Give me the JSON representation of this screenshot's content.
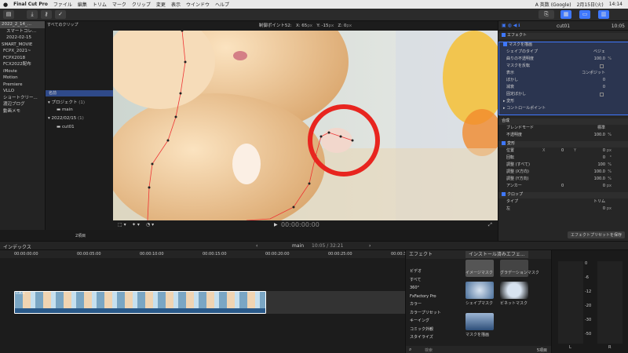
{
  "menubar": {
    "app": "Final Cut Pro",
    "items": [
      "ファイル",
      "編集",
      "トリム",
      "マーク",
      "クリップ",
      "変更",
      "表示",
      "ウインドウ",
      "ヘルプ"
    ],
    "input": "A 英数 (Google)",
    "date": "2月15日(火)",
    "time": "14:14"
  },
  "library": {
    "items": [
      "2022_2_14_...",
      "スマートコレ...",
      "2022-02-15",
      "SMART_MOVIE",
      "FCPX_2021~",
      "FCPX2018",
      "FCX2022配布",
      "iMovie",
      "Motion",
      "Premiere",
      "VLLO",
      "ショートクリー...",
      "渡辺ブログ",
      "動画メモ"
    ]
  },
  "browser": {
    "filter": "すべてのクリップ",
    "col_header": "名前",
    "items": [
      {
        "label": "プロジェクト",
        "count": "(1)"
      },
      {
        "label": "main",
        "count": ""
      },
      {
        "label": "2022/02/15",
        "count": "(1)"
      },
      {
        "label": "cut01",
        "count": ""
      }
    ],
    "footer": "2項目"
  },
  "viewer": {
    "hud": "制御ポイント52:",
    "x": "X: 65",
    "xunit": "px",
    "y": "Y: -15",
    "yunit": "px",
    "z": "Z: 0",
    "zunit": "px",
    "timecode": "00:00:00:00"
  },
  "inspector": {
    "clipname": "cut01",
    "duration": "10:05",
    "effects_label": "エフェクト",
    "mask_label": "マスクを描画",
    "shape_type_label": "シェイプのタイプ",
    "shape_type_value": "ベジェ",
    "outer_opacity_label": "曲りの不透明度",
    "outer_opacity_value": "100.0",
    "invert_label": "マスクを反転",
    "display_label": "表示",
    "display_value": "コンポジット",
    "feather_label": "ぼかし",
    "feather_value": "0",
    "falloff_label": "減衰",
    "falloff_value": "0",
    "fixed_label": "固定ぼかし",
    "transform_label": "変形",
    "control_label": "コントロールポイント",
    "composite_label": "合成",
    "blend_label": "ブレンドモード",
    "blend_value": "標準",
    "opacity_label": "不透明度",
    "opacity_value": "100.0",
    "transform2_label": "変形",
    "position_label": "位置",
    "pos_x": "0",
    "pos_y": "0",
    "rotation_label": "回転",
    "rotation_value": "0",
    "scale_all_label": "調整 (すべて)",
    "scale_all_value": "100",
    "scale_x_label": "調整 (X方向)",
    "scale_x_value": "100.0",
    "scale_y_label": "調整 (Y方向)",
    "scale_y_value": "100.0",
    "anchor_label": "アンカー",
    "anchor_x": "0",
    "anchor_y": "0",
    "crop_label": "クロップ",
    "type_label": "タイプ",
    "type_value": "トリム",
    "left_label": "左",
    "left_value": "0",
    "save_preset": "エフェクトプリセットを保存",
    "px": "px",
    "pct": "%",
    "deg": "°",
    "X": "X",
    "Y": "Y"
  },
  "timeline": {
    "index_label": "インデックス",
    "project": "main",
    "timecode": "10:05 / 32:21",
    "ruler": [
      "00:00:00:00",
      "00:00:05:00",
      "00:00:10:00",
      "00:00:15:00",
      "00:00:20:00",
      "00:00:25:00",
      "00:00:30:00"
    ],
    "clip_label": "cut01"
  },
  "effects": {
    "title": "エフェクト",
    "dropdown": "インストール済みエフェ...",
    "categories": [
      "ビデオ",
      "すべて",
      "360°",
      "FxFactory Pro",
      "カラー",
      "カラープリセット",
      "キーイング",
      "コミック外観",
      "スタイライズ"
    ],
    "thumbs": [
      "イメージマスク",
      "グラデーションマスク",
      "シェイプマスク",
      "ビネットマスク",
      "マスクを描画"
    ],
    "search_placeholder": "検索",
    "count": "5項目"
  },
  "meters": {
    "labels": [
      "0",
      "-6",
      "-12",
      "-20",
      "-30",
      "-50"
    ],
    "L": "L",
    "R": "R"
  },
  "colors": {
    "accent": "#3f78ff",
    "mask_line": "#e33",
    "annotation": "#e8251f"
  }
}
